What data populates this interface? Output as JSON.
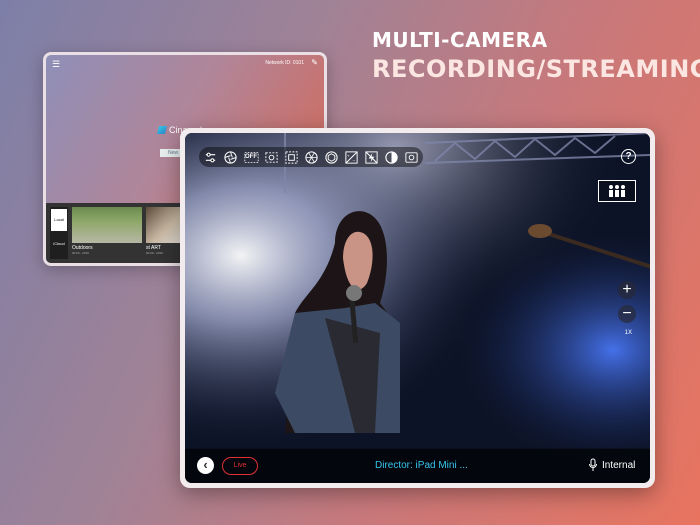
{
  "promo": {
    "line1": "MULTI-CAMERA",
    "line2": "RECORDING/STREAMING"
  },
  "back_screen": {
    "network_id": "Network ID: 0101",
    "app_name": "Cinamaker",
    "new_button": "New",
    "library_tabs": [
      "Local",
      "iCloud"
    ],
    "projects": [
      {
        "title": "Outdoors",
        "subtitle": "00:00 - 2019"
      },
      {
        "title": "st ART",
        "subtitle": "00:00 - 2019"
      }
    ]
  },
  "front_screen": {
    "toolbar": [
      "settings-sliders-icon",
      "aperture-icon",
      "off-toggle",
      "exposure-lock-icon",
      "focus-frame-icon",
      "shutter-icon",
      "iris-icon",
      "exposure-compensation-icon",
      "no-flash-icon",
      "contrast-icon",
      "camera-switch-icon"
    ],
    "toolbar_off_label": "OFF",
    "help_label": "?",
    "zoom_in_label": "+",
    "zoom_out_label": "−",
    "zoom_level": "1X",
    "back_label": "‹",
    "live_label": "Live",
    "director": "Director: iPad Mini ...",
    "audio_source": "Internal"
  },
  "colors": {
    "accent_cyan": "#38c6ee",
    "live_red": "#e03030"
  }
}
